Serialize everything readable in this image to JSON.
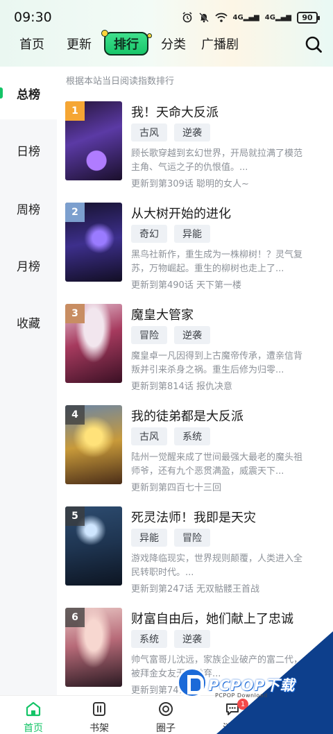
{
  "status_bar": {
    "time": "09:30",
    "signal_1": "4G",
    "signal_2": "4G",
    "battery": "90"
  },
  "top_nav": {
    "items": [
      "首页",
      "更新",
      "排行",
      "分类",
      "广播剧"
    ],
    "active": "排行"
  },
  "sidebar": {
    "items": [
      "总榜",
      "日榜",
      "周榜",
      "月榜",
      "收藏"
    ],
    "active": "总榜"
  },
  "list_hint": "根据本站当日阅读指数排行",
  "comics": [
    {
      "rank": "1",
      "title": "我！天命大反派",
      "tags": [
        "古风",
        "逆袭"
      ],
      "desc": "顾长歌穿越到玄幻世界，开局就拉满了模范主角、气运之子的仇恨值。...",
      "update": "更新到第309话 聪明的女人~",
      "accent": "#6b3fb5"
    },
    {
      "rank": "2",
      "title": "从大树开始的进化",
      "tags": [
        "奇幻",
        "异能"
      ],
      "desc": "黑鸟社新作，重生成为一株柳树！？灵气复苏，万物崛起。重生的柳树也走上了...",
      "update": "更新到第490话 天下第一楼",
      "accent": "#3a2f8f"
    },
    {
      "rank": "3",
      "title": "魔皇大管家",
      "tags": [
        "冒险",
        "逆袭"
      ],
      "desc": "魔皇卓一凡因得到上古魔帝传承，遭亲信背叛并引来杀身之祸。重生后修为归零...",
      "update": "更新到第814话 报仇决意",
      "accent": "#8a2a4a"
    },
    {
      "rank": "4",
      "title": "我的徒弟都是大反派",
      "tags": [
        "古风",
        "系统"
      ],
      "desc": "陆州一觉醒来成了世间最强大最老的魔头祖师爷，还有九个恶贯满盈，威震天下...",
      "update": "更新到第四百七十三回",
      "accent": "#b88a2a"
    },
    {
      "rank": "5",
      "title": "死灵法师！我即是天灾",
      "tags": [
        "异能",
        "冒险"
      ],
      "desc": "游戏降临现实，世界规则颠覆，人类进入全民转职时代。...",
      "update": "更新到第247话 无双骷髅王首战",
      "accent": "#2a4a6a"
    },
    {
      "rank": "6",
      "title": "财富自由后，她们献上了忠诚",
      "tags": [
        "系统",
        "逆袭"
      ],
      "desc": "帅气富哥儿沈远，家族企业破产的富二代，被拜金女友无情抛弃...",
      "update": "更新到第74话",
      "accent": "#b56a7a"
    }
  ],
  "tabbar": {
    "items": [
      "首页",
      "书架",
      "圈子",
      "消息"
    ],
    "active": "首页",
    "message_badge": "1"
  },
  "watermark": {
    "text": "PCPOP下载",
    "sub": "PCPOP Download"
  },
  "colors": {
    "accent": "#14c467",
    "rank_gold": "#f5a634",
    "rank_silver": "#7c9fce",
    "rank_bronze": "#c88d62"
  }
}
